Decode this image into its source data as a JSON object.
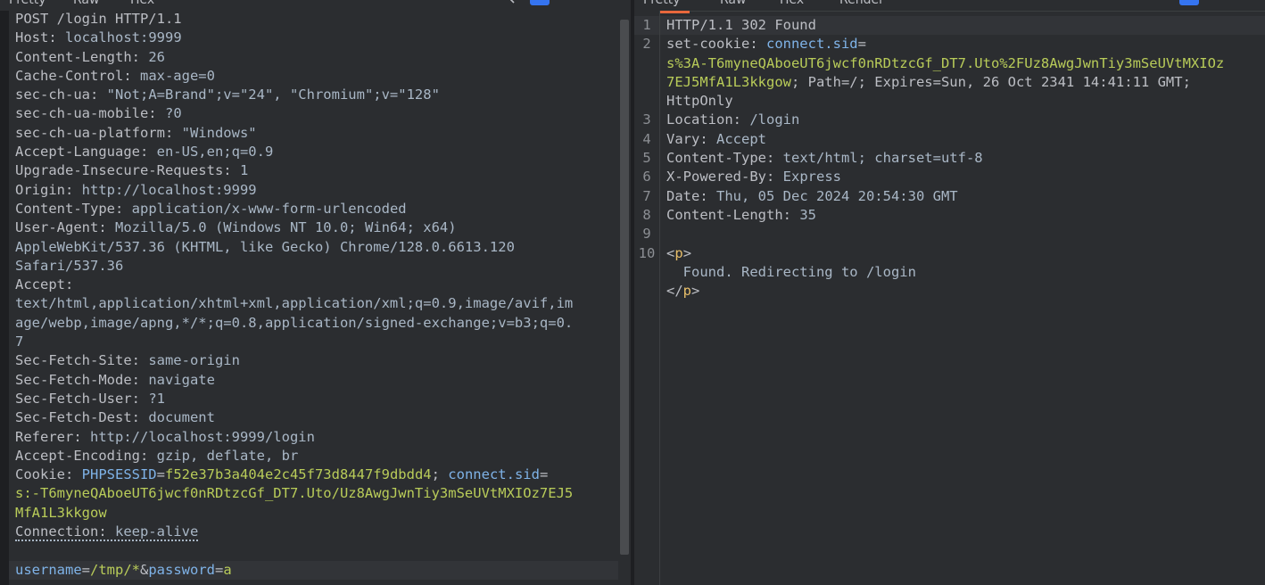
{
  "left_tabs": [
    "Pretty",
    "Raw",
    "Hex"
  ],
  "right_tabs": [
    "Pretty",
    "Raw",
    "Hex",
    "Render"
  ],
  "icons": {
    "search": "search-icon",
    "wrap": "wrap-toggle-icon",
    "newline": "newline-icon",
    "menu": "menu-icon"
  },
  "request": {
    "request_line": "POST /login HTTP/1.1",
    "headers": [
      {
        "k": "Host: ",
        "v": "localhost:9999"
      },
      {
        "k": "Content-Length: ",
        "v": "26"
      },
      {
        "k": "Cache-Control: ",
        "v": "max-age=0"
      },
      {
        "k": "sec-ch-ua: ",
        "v": "\"Not;A=Brand\";v=\"24\", \"Chromium\";v=\"128\""
      },
      {
        "k": "sec-ch-ua-mobile: ",
        "v": "?0"
      },
      {
        "k": "sec-ch-ua-platform: ",
        "v": "\"Windows\""
      },
      {
        "k": "Accept-Language: ",
        "v": "en-US,en;q=0.9"
      },
      {
        "k": "Upgrade-Insecure-Requests: ",
        "v": "1"
      },
      {
        "k": "Origin: ",
        "v": "http://localhost:9999"
      },
      {
        "k": "Content-Type: ",
        "v": "application/x-www-form-urlencoded"
      },
      {
        "k": "User-Agent: ",
        "v": "Mozilla/5.0 (Windows NT 10.0; Win64; x64)"
      }
    ],
    "ua_cont": [
      "AppleWebKit/537.36 (KHTML, like Gecko) Chrome/128.0.6613.120",
      "Safari/537.36"
    ],
    "accept_key": "Accept:",
    "accept_cont": [
      "text/html,application/xhtml+xml,application/xml;q=0.9,image/avif,im",
      "age/webp,image/apng,*/*;q=0.8,application/signed-exchange;v=b3;q=0.",
      "7"
    ],
    "headers2": [
      {
        "k": "Sec-Fetch-Site: ",
        "v": "same-origin"
      },
      {
        "k": "Sec-Fetch-Mode: ",
        "v": "navigate"
      },
      {
        "k": "Sec-Fetch-User: ",
        "v": "?1"
      },
      {
        "k": "Sec-Fetch-Dest: ",
        "v": "document"
      },
      {
        "k": "Referer: ",
        "v": "http://localhost:9999/login"
      },
      {
        "k": "Accept-Encoding: ",
        "v": "gzip, deflate, br"
      }
    ],
    "cookie": {
      "k": "Cookie: ",
      "name1": "PHPSESSID",
      "eq": "=",
      "val1": "f52e37b3a404e2c45f73d8447f9dbdd4",
      "sep": "; ",
      "name2": "connect.sid",
      "eq2": "=",
      "val2_l1": "s:-T6myneQAboeUT6jwcf0nRDtzcGf_DT7.Uto/Uz8AwgJwnTiy3mSeUVtMXIOz7EJ5",
      "val2_l2": "MfA1L3kkgow"
    },
    "connection": {
      "k": "Connection: ",
      "v": "keep-alive"
    },
    "body": {
      "p1": "username",
      "eq1": "=",
      "v1": "/tmp/*",
      "amp": "&",
      "p2": "password",
      "eq2": "=",
      "v2": "a"
    }
  },
  "response": {
    "line_numbers": [
      "1",
      "2",
      "3",
      "4",
      "5",
      "6",
      "7",
      "8",
      "9",
      "10"
    ],
    "status": "HTTP/1.1 302 Found",
    "setcookie": {
      "k": "set-cookie: ",
      "name": "connect.sid",
      "eq": "=",
      "v_l1": "s%3A-T6myneQAboeUT6jwcf0nRDtzcGf_DT7.Uto%2FUz8AwgJwnTiy3mSeUVtMXIOz",
      "v_l2": "7EJ5MfA1L3kkgow",
      "rest": "; Path=/; Expires=Sun, 26 Oct 2341 14:41:11 GMT;",
      "rest2": "HttpOnly"
    },
    "headers": [
      {
        "k": "Location: ",
        "v": "/login"
      },
      {
        "k": "Vary: ",
        "v": "Accept"
      },
      {
        "k": "Content-Type: ",
        "v": "text/html; charset=utf-8"
      },
      {
        "k": "X-Powered-By: ",
        "v": "Express"
      },
      {
        "k": "Date: ",
        "v": "Thu, 05 Dec 2024 20:54:30 GMT"
      },
      {
        "k": "Content-Length: ",
        "v": "35"
      }
    ],
    "html": {
      "open_lt": "<",
      "tag": "p",
      "open_gt": ">",
      "text": "  Found. Redirecting to /login",
      "close_lt": "</",
      "close_gt": ">"
    }
  }
}
